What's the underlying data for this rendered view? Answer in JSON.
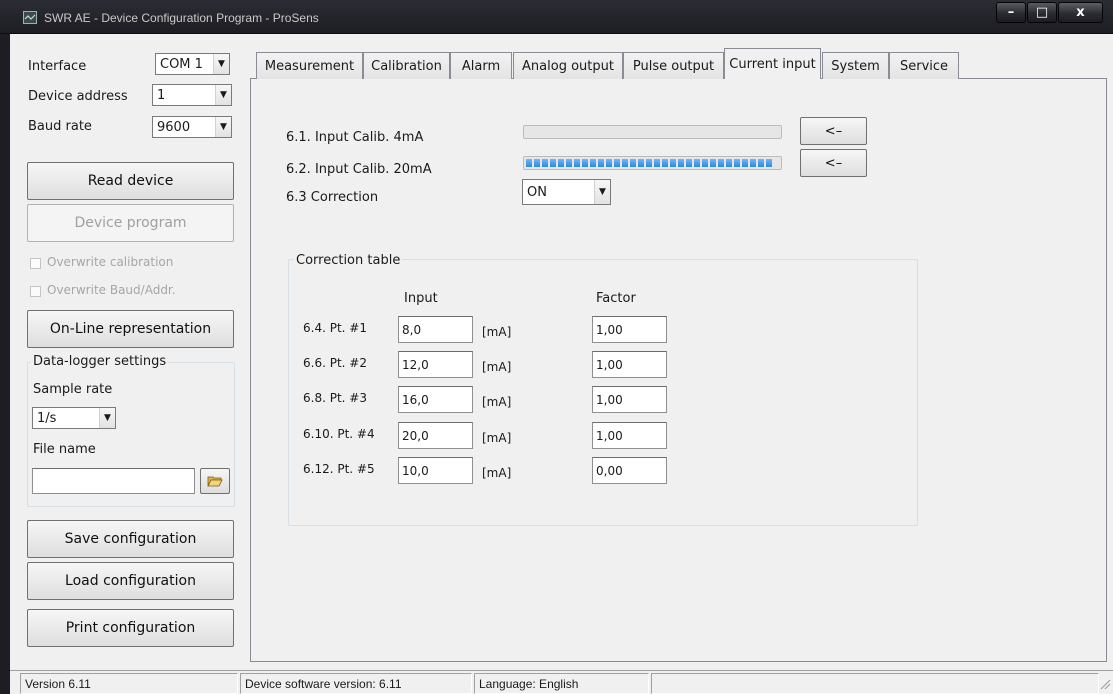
{
  "window": {
    "title": "SWR AE - Device Configuration Program - ProSens",
    "icon": "app-monitor-icon",
    "minimize_label": "–",
    "maximize_label": "□",
    "close_label": "x"
  },
  "sidebar": {
    "interface_label": "Interface",
    "interface_value": "COM 1",
    "device_address_label": "Device address",
    "device_address_value": "1",
    "baud_rate_label": "Baud rate",
    "baud_rate_value": "9600",
    "read_device_label": "Read device",
    "device_program_label": "Device program",
    "overwrite_calibration_label": "Overwrite calibration",
    "overwrite_baud_label": "Overwrite Baud/Addr.",
    "online_label": "On-Line representation",
    "datalogger": {
      "title": "Data-logger settings",
      "sample_rate_label": "Sample rate",
      "sample_rate_value": "1/s",
      "file_name_label": "File name",
      "file_name_value": ""
    },
    "save_label": "Save configuration",
    "load_label": "Load configuration",
    "print_label": "Print configuration"
  },
  "tabs": [
    {
      "label": "Measurement"
    },
    {
      "label": "Calibration"
    },
    {
      "label": "Alarm"
    },
    {
      "label": "Analog output"
    },
    {
      "label": "Pulse output"
    },
    {
      "label": "Current input",
      "active": true
    },
    {
      "label": "System"
    },
    {
      "label": "Service"
    }
  ],
  "current_input": {
    "calib_4ma_label": "6.1. Input Calib. 4mA",
    "calib_4ma_progress": 0,
    "calib_20ma_label": "6.2. Input Calib. 20mA",
    "calib_20ma_progress": 1.0,
    "apply_button_label": "<–",
    "correction_label": "6.3 Correction",
    "correction_value": "ON",
    "table": {
      "title": "Correction table",
      "input_header": "Input",
      "factor_header": "Factor",
      "rows": [
        {
          "label": "6.4. Pt. #1",
          "input": "8,0",
          "unit": "[mA]",
          "factor": "1,00"
        },
        {
          "label": "6.6. Pt. #2",
          "input": "12,0",
          "unit": "[mA]",
          "factor": "1,00"
        },
        {
          "label": "6.8. Pt. #3",
          "input": "16,0",
          "unit": "[mA]",
          "factor": "1,00"
        },
        {
          "label": "6.10. Pt. #4",
          "input": "20,0",
          "unit": "[mA]",
          "factor": "1,00"
        },
        {
          "label": "6.12. Pt. #5",
          "input": "10,0",
          "unit": "[mA]",
          "factor": "0,00"
        }
      ]
    }
  },
  "statusbar": {
    "version": "Version 6.11",
    "device_software": "Device software version: 6.11",
    "language": "Language: English"
  },
  "colors": {
    "progress_fill": "#2a8be0",
    "titlebar": "#1d1d23"
  }
}
